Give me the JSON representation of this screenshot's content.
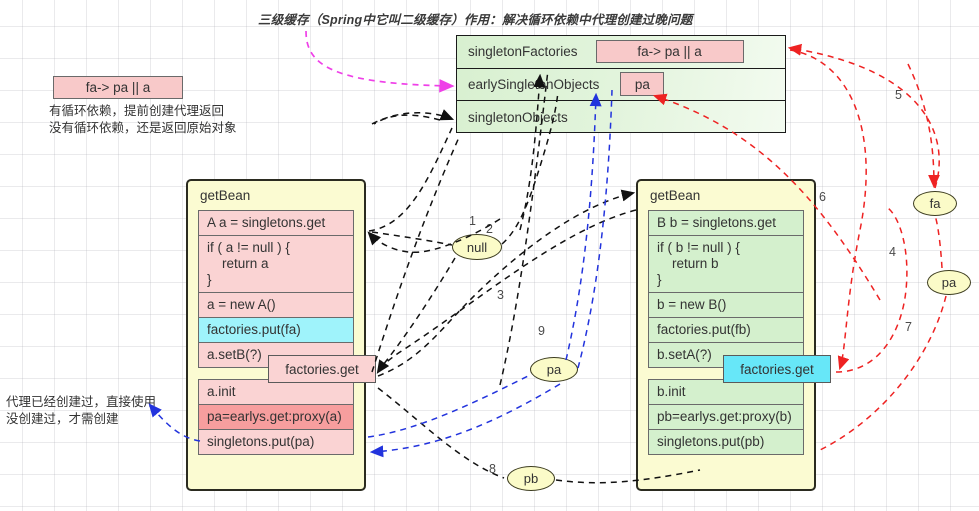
{
  "title": "三级缓存（Spring中它叫二级缓存）作用：解决循环依赖中代理创建过晚问题",
  "colors": {
    "green_fill": "#d4f0cd",
    "pink_fill": "#fad3d3",
    "cyan_fill": "#67e7f8",
    "yellow_panel": "#fbfbd2",
    "ellipse_fill": "#fbfbc8",
    "red_edge": "#ee2222",
    "blue_edge": "#2233dd",
    "black_edge": "#111111",
    "magenta_edge": "#ef40e8",
    "highlight_red": "#f79e9e"
  },
  "cache": {
    "rows": [
      {
        "label": "singletonFactories",
        "chip": "fa-> pa || a"
      },
      {
        "label": "earlySingletonObjects",
        "chip": "pa"
      },
      {
        "label": "singletonObjects",
        "chip": ""
      }
    ]
  },
  "legend": {
    "chip": "fa-> pa || a",
    "line1": "有循环依赖，提前创建代理返回",
    "line2": "没有循环依赖，还是返回原始对象"
  },
  "note_left": {
    "line1": "代理已经创建过，直接使用",
    "line2": "没创建过，才需创建"
  },
  "panelA": {
    "title": "getBean",
    "group1": [
      "A a = singletons.get",
      "if ( a != null ) {\n    return a\n}",
      "a = new A()",
      "factories.put(fa)",
      "a.setB(?)"
    ],
    "group2": [
      "a.init",
      "pa=earlys.get:proxy(a)",
      "singletons.put(pa)"
    ],
    "callout": "factories.get"
  },
  "panelB": {
    "title": "getBean",
    "group1": [
      "B b = singletons.get",
      "if ( b != null ) {\n    return b\n}",
      "b = new B()",
      "factories.put(fb)",
      "b.setA(?)"
    ],
    "group2": [
      "b.init",
      "pb=earlys.get:proxy(b)",
      "singletons.put(pb)"
    ],
    "callout": "factories.get"
  },
  "ellipses": {
    "null": "null",
    "pa_mid": "pa",
    "pb": "pb",
    "fa": "fa",
    "pa_right": "pa"
  },
  "edge_labels": {
    "n1": "1",
    "n2": "2",
    "n3": "3",
    "n4": "4",
    "n5": "5",
    "n6": "6",
    "n7": "7",
    "n8": "8",
    "n9": "9"
  }
}
